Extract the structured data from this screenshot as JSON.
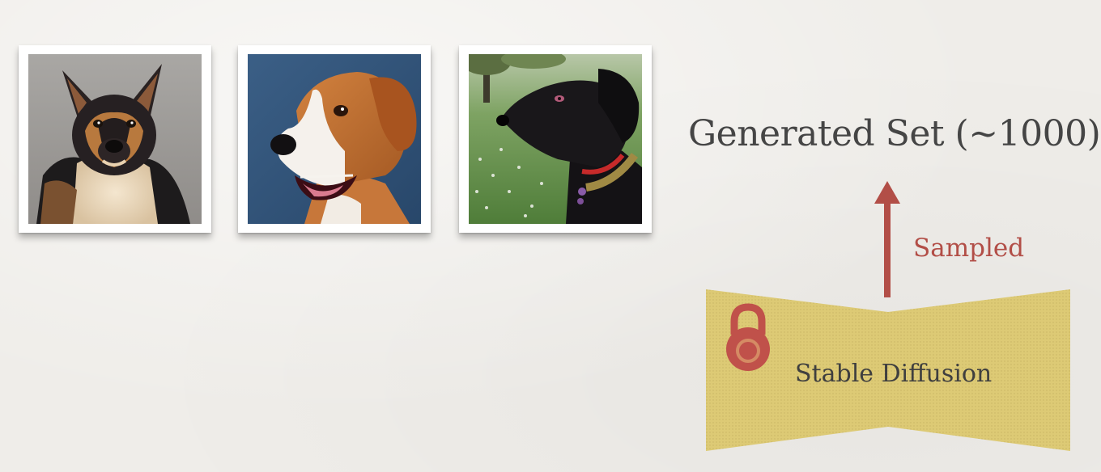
{
  "generated_set": {
    "title": "Generated Set (~1000)"
  },
  "arrow": {
    "label": "Sampled",
    "color": "#b24e47"
  },
  "model": {
    "label": "Stable Diffusion",
    "fill_color": "#ddca75",
    "icon": "lock-icon",
    "icon_color": "#c0514a"
  },
  "images": [
    {
      "subject": "tricolor shepherd-mix dog"
    },
    {
      "subject": "beagle dog with open mouth"
    },
    {
      "subject": "black dog on grass in park"
    }
  ]
}
